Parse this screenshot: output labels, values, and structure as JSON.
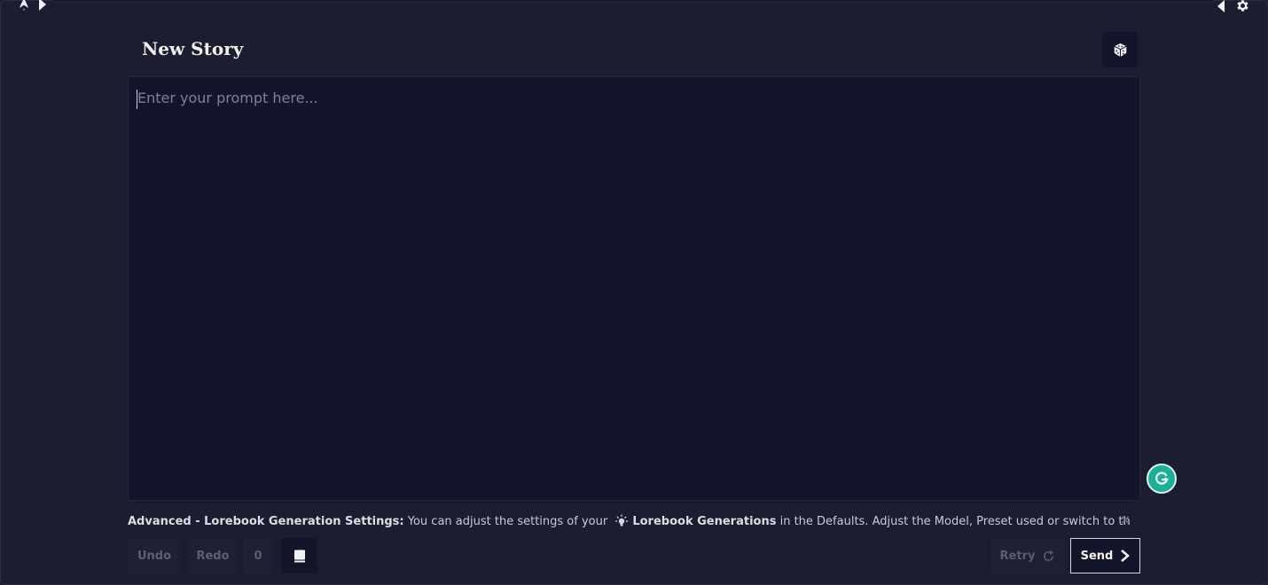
{
  "window": {
    "title": "New Story"
  },
  "topbar": {
    "left_icons": [
      "logo-icon",
      "expand-left-sidebar-icon"
    ],
    "right_icons": [
      "expand-right-sidebar-icon",
      "settings-icon"
    ]
  },
  "header": {
    "title": "New Story",
    "random_button_icon": "dice-icon"
  },
  "editor": {
    "value": "",
    "placeholder": "Enter your prompt here..."
  },
  "notice": {
    "bold_prefix": "Advanced - Lorebook Generation Settings:",
    "text_before": " You can adjust the settings of your ",
    "icon": "lightbulb-icon",
    "bold_link": "Lorebook Generations",
    "text_after": " in the Defaults. Adjust the Model, Preset used or switch to the Legacy Lore…",
    "close_label": "×"
  },
  "toolbar": {
    "undo_label": "Undo",
    "redo_label": "Redo",
    "history_count": "0",
    "book_icon": "book-icon",
    "retry_label": "Retry",
    "send_label": "Send"
  },
  "colors": {
    "background": "#1b1d30",
    "editor_bg": "#13152b",
    "accent_text": "#f4f1ea",
    "grammarly": "#16b39a"
  }
}
